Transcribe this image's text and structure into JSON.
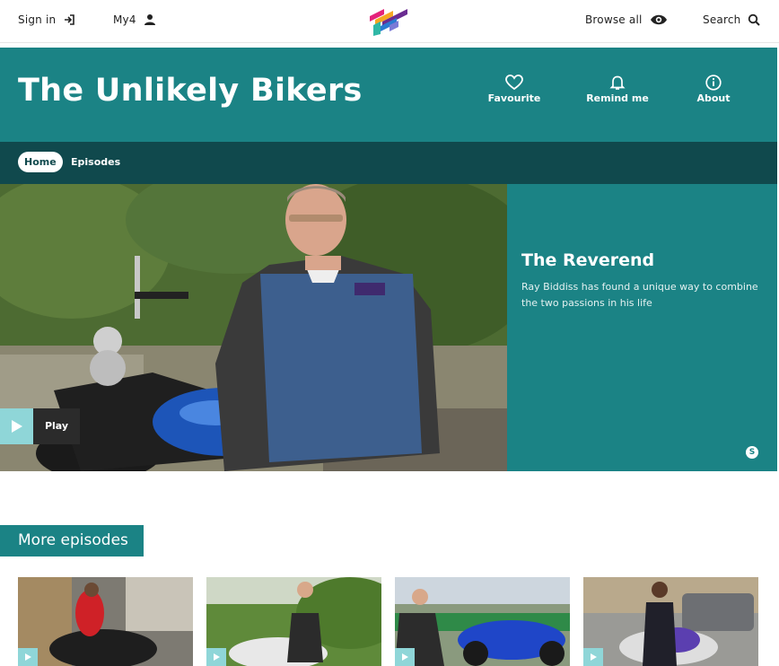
{
  "topbar": {
    "sign_in": "Sign in",
    "my4": "My4",
    "browse_all": "Browse all",
    "search": "Search"
  },
  "show": {
    "title": "The Unlikely Bikers",
    "actions": {
      "favourite": "Favourite",
      "remind": "Remind me",
      "about": "About"
    }
  },
  "subnav": {
    "home": "Home",
    "episodes": "Episodes"
  },
  "feature": {
    "title": "The Reverend",
    "description": "Ray Biddiss has found a unique way to combine the two passions in his life",
    "rating": "S",
    "play": "Play"
  },
  "more": {
    "heading": "More episodes"
  },
  "colors": {
    "teal": "#1b8385",
    "dark_teal": "#10494d",
    "play_accent": "#8fd6d8"
  }
}
